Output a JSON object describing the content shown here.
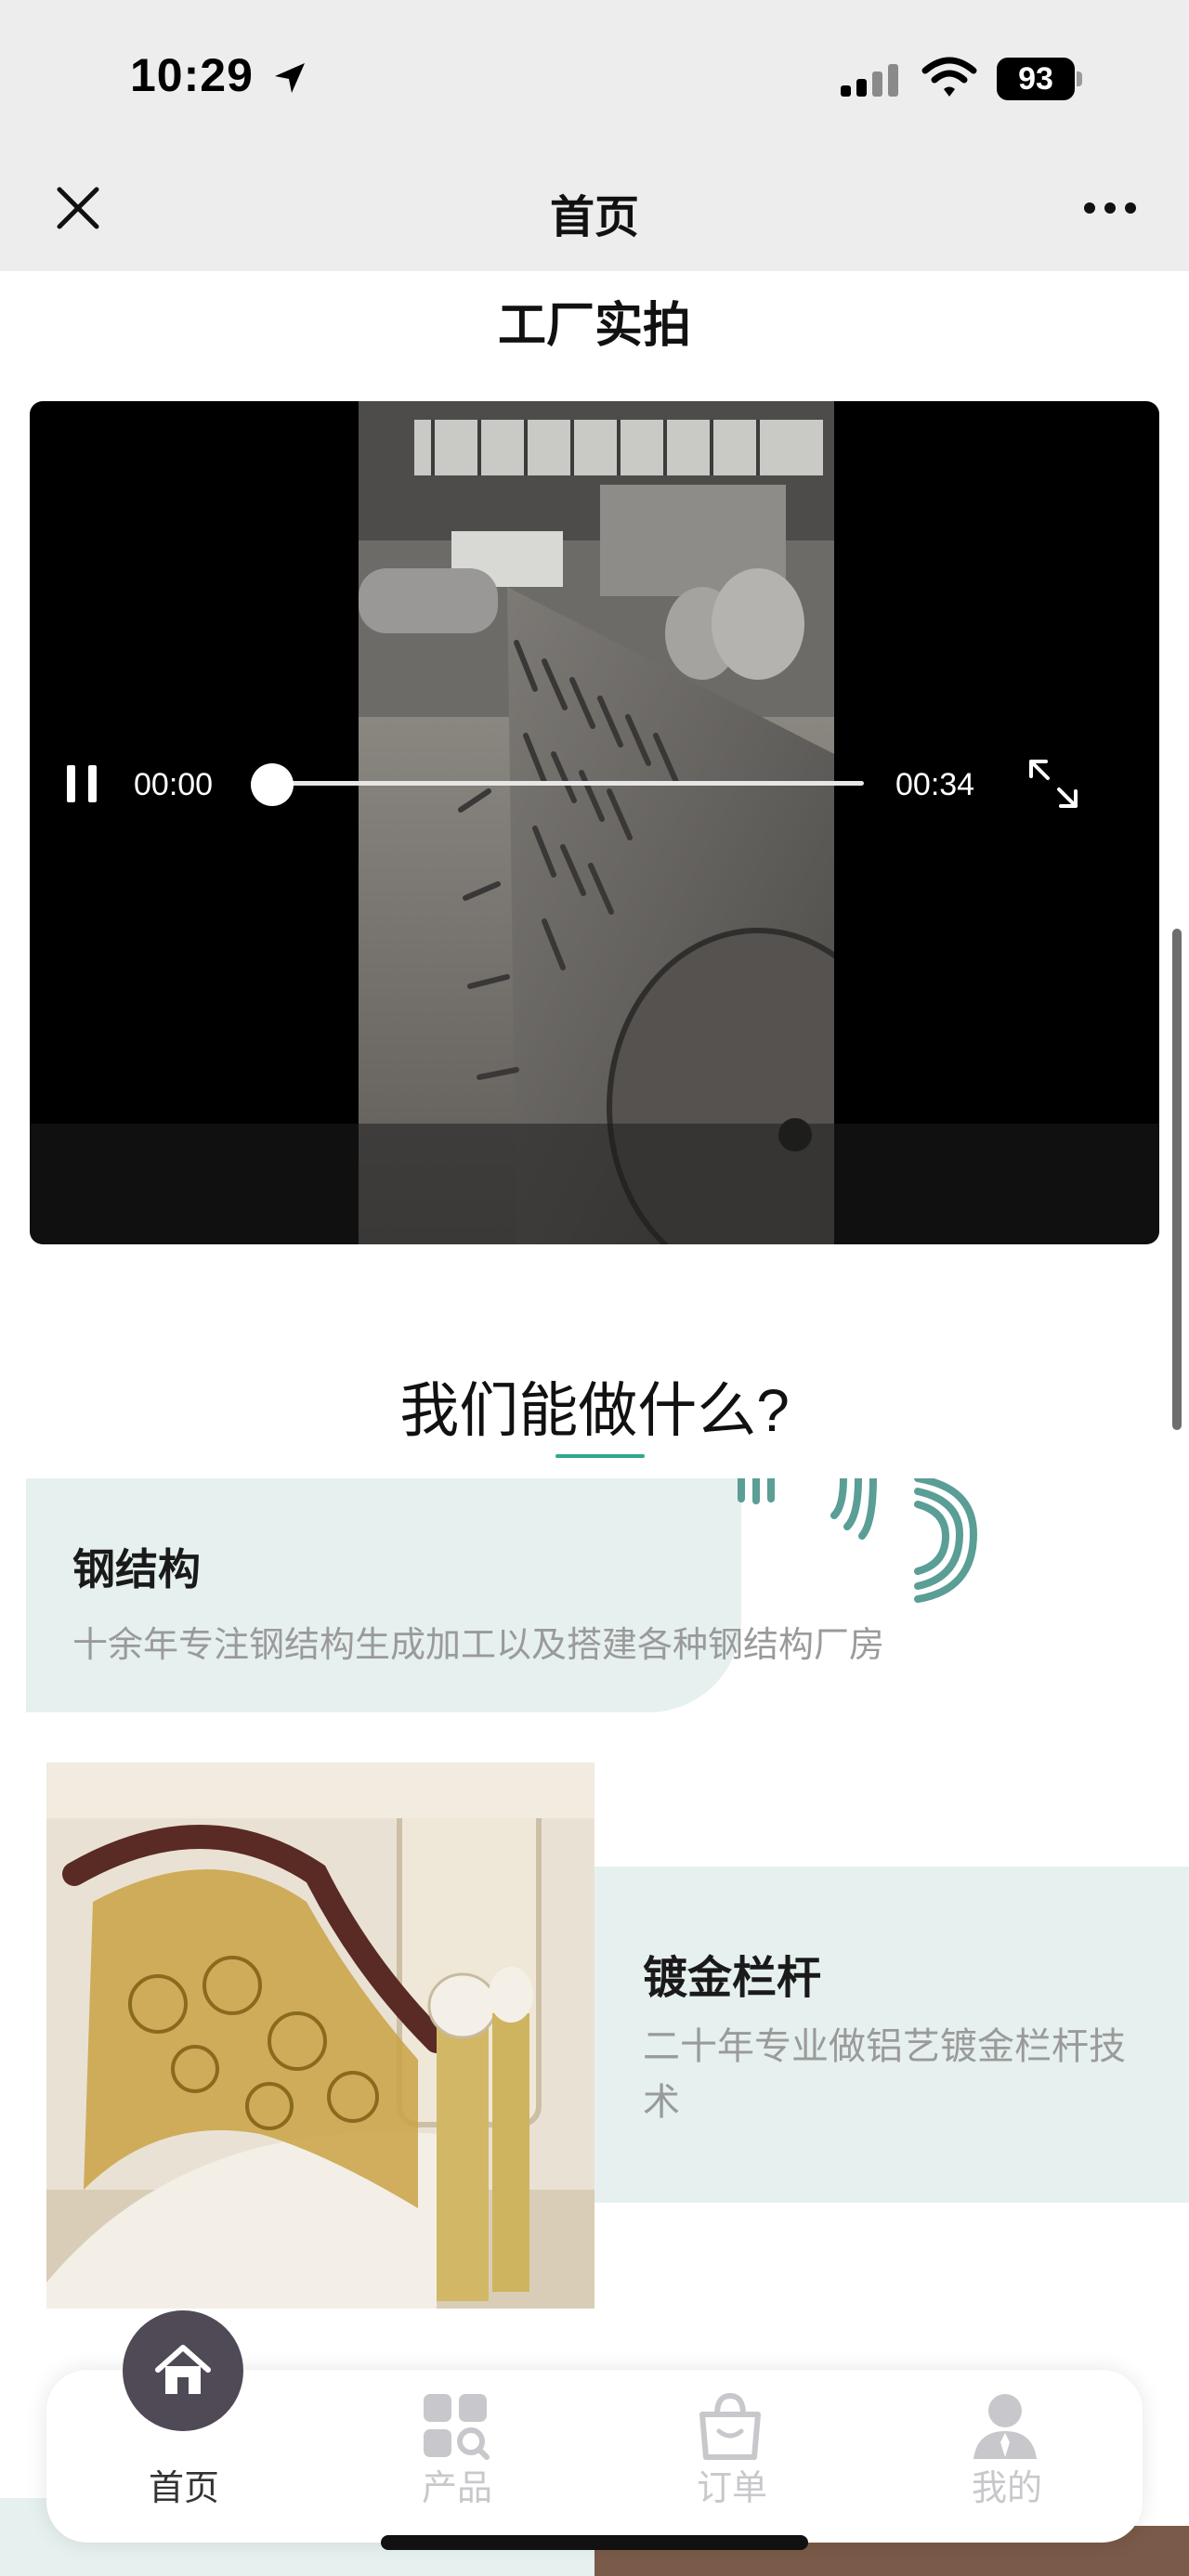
{
  "status_bar": {
    "time": "10:29",
    "battery": "93",
    "icons": [
      "location-arrow-icon",
      "cellular-signal-icon",
      "wifi-icon",
      "battery-icon"
    ]
  },
  "nav": {
    "title": "首页",
    "close_icon": "close-icon",
    "more_icon": "more-icon"
  },
  "factory": {
    "title": "工厂实拍",
    "video": {
      "current_time": "00:00",
      "total_time": "00:34",
      "progress": 0
    }
  },
  "services": {
    "title": "我们能做什么?",
    "items": [
      {
        "title": "钢结构",
        "desc": "十余年专注钢结构生成加工以及搭建各种钢结构厂房"
      },
      {
        "title": "镀金栏杆",
        "desc": "二十年专业做铝艺镀金栏杆技术"
      }
    ]
  },
  "tab_bar": {
    "items": [
      {
        "label": "首页",
        "icon": "home-icon",
        "active": true
      },
      {
        "label": "产品",
        "icon": "grid-search-icon",
        "active": false
      },
      {
        "label": "订单",
        "icon": "shopping-bag-icon",
        "active": false
      },
      {
        "label": "我的",
        "icon": "user-icon",
        "active": false
      }
    ]
  },
  "colors": {
    "accent": "#2ea88a",
    "card_bg": "#e6f0ef",
    "tab_active": "#4f4a56",
    "tab_inactive": "#c8c8cc"
  }
}
